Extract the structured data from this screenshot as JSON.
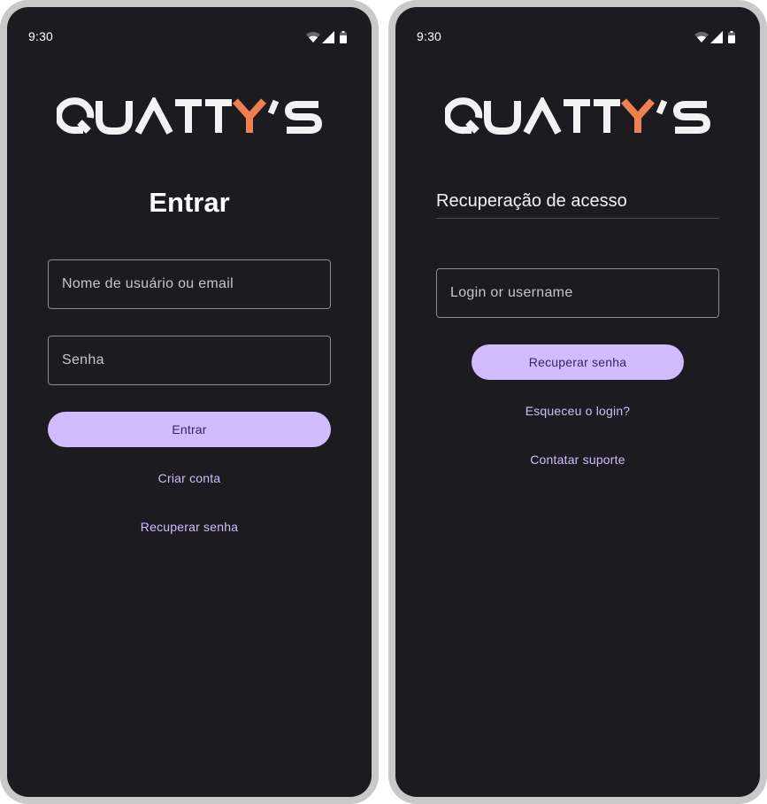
{
  "left_screen": {
    "status_time": "9:30",
    "logo_text": "QUATTY'S",
    "title": "Entrar",
    "username_placeholder": "Nome de usuário ou email",
    "password_placeholder": "Senha",
    "login_button": "Entrar",
    "create_account_link": "Criar conta",
    "recover_password_link": "Recuperar senha"
  },
  "right_screen": {
    "status_time": "9:30",
    "logo_text": "QUATTY'S",
    "title": "Recuperação de acesso",
    "login_placeholder": "Login or username",
    "recover_button": "Recuperar senha",
    "forgot_login_link": "Esqueceu o login?",
    "contact_support_link": "Contatar suporte"
  },
  "colors": {
    "background": "#1c1b20",
    "accent": "#d0bcff",
    "accent_text": "#381e72",
    "logo_white": "#f2f2f2",
    "logo_orange": "#f08050"
  },
  "icons": [
    "wifi-icon",
    "signal-icon",
    "battery-icon"
  ]
}
